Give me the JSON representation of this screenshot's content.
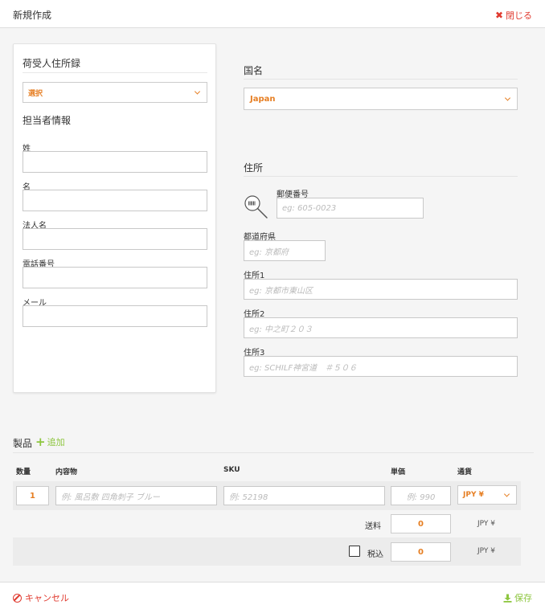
{
  "header": {
    "title": "新規作成",
    "close_label": "閉じる"
  },
  "consignee": {
    "address_book_title": "荷受人住所録",
    "address_book_select": "選択",
    "contact_title": "担当者情報",
    "fields": [
      {
        "label": "姓",
        "value": ""
      },
      {
        "label": "名",
        "value": ""
      },
      {
        "label": "法人名",
        "value": ""
      },
      {
        "label": "電話番号",
        "value": ""
      },
      {
        "label": "メール",
        "value": ""
      }
    ]
  },
  "country": {
    "title": "国名",
    "selected": "Japan"
  },
  "address": {
    "title": "住所",
    "postal_label": "郵便番号",
    "postal_placeholder": "eg: 605-0023",
    "prefecture_label": "都道府県",
    "prefecture_placeholder": "eg: 京都府",
    "address1_label": "住所1",
    "address1_placeholder": "eg: 京都市東山区",
    "address2_label": "住所2",
    "address2_placeholder": "eg: 中之町２０３",
    "address3_label": "住所3",
    "address3_placeholder": "eg: SCHILF神宮道　＃５０６"
  },
  "products": {
    "title": "製品",
    "add_label": "追加",
    "columns": {
      "qty": "数量",
      "contents": "内容物",
      "sku": "SKU",
      "price": "単価",
      "currency": "通貨"
    },
    "row": {
      "qty": "1",
      "contents_placeholder": "例: 風呂敷 四角刺子 ブルー",
      "sku_placeholder": "例: 52198",
      "price_placeholder": "例: 990",
      "currency": "JPY ¥"
    },
    "shipping_label": "送料",
    "shipping_value": "0",
    "shipping_currency": "JPY ¥",
    "tax_label": "税込",
    "tax_value": "0",
    "tax_currency": "JPY ¥"
  },
  "footer": {
    "cancel_label": "キャンセル",
    "save_label": "保存"
  },
  "colors": {
    "accent_orange": "#e67e22",
    "danger_red": "#e03a2f",
    "success_green": "#8dc63f"
  }
}
